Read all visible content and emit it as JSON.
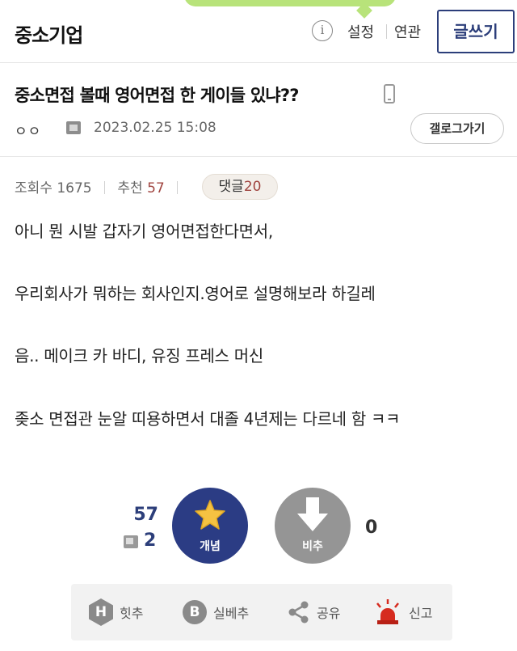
{
  "header": {
    "gallery_name": "중소기업",
    "info_icon": "info-icon",
    "settings_label": "설정",
    "related_label": "연관",
    "write_label": "글쓰기"
  },
  "post": {
    "title": "중소면접 볼때 영어면접 한 게이들 있냐??",
    "device_icon": "mobile-phone-icon",
    "author": "ㅇㅇ",
    "author_icon": "fixed-nick-icon",
    "date": "2023.02.25 15:08",
    "gallery_button": "갤로그가기"
  },
  "stats": {
    "views_label": "조회수",
    "views": "1675",
    "recommend_label": "추천",
    "recommend": "57",
    "comments_label": "댓글",
    "comments": "20"
  },
  "body": {
    "lines": [
      "아니 뭔 시발 갑자기 영어면접한다면서,",
      "우리회사가 뭐하는 회사인지.영어로 설명해보라 하길레",
      "음.. 메이크 카 바디, 유징 프레스 머신",
      "좆소 면접관 눈알 띠용하면서 대졸 4년제는 다르네 함 ㅋㅋ"
    ]
  },
  "vote": {
    "up_count": "57",
    "fixed_count": "2",
    "up_label": "개념",
    "down_label": "비추",
    "down_count": "0",
    "up_color": "#2b3c84",
    "down_color": "#959595"
  },
  "actions": {
    "hit_label": "힛추",
    "best_label": "실베추",
    "share_label": "공유",
    "report_label": "신고"
  },
  "colors": {
    "accent": "#2c3e7a",
    "count_red": "#a0443f",
    "siren_red": "#d62b1f"
  }
}
